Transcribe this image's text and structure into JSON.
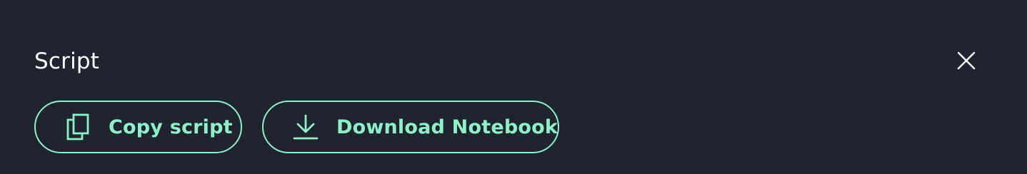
{
  "panel": {
    "title": "Script"
  },
  "actions": {
    "copy_label": "Copy script",
    "download_label": "Download Notebook"
  },
  "icons": {
    "close": "close-icon",
    "copy": "copy-icon",
    "download": "download-icon"
  },
  "colors": {
    "background": "#1f2430",
    "accent": "#8ef0c7",
    "title_text": "#ffffff"
  }
}
